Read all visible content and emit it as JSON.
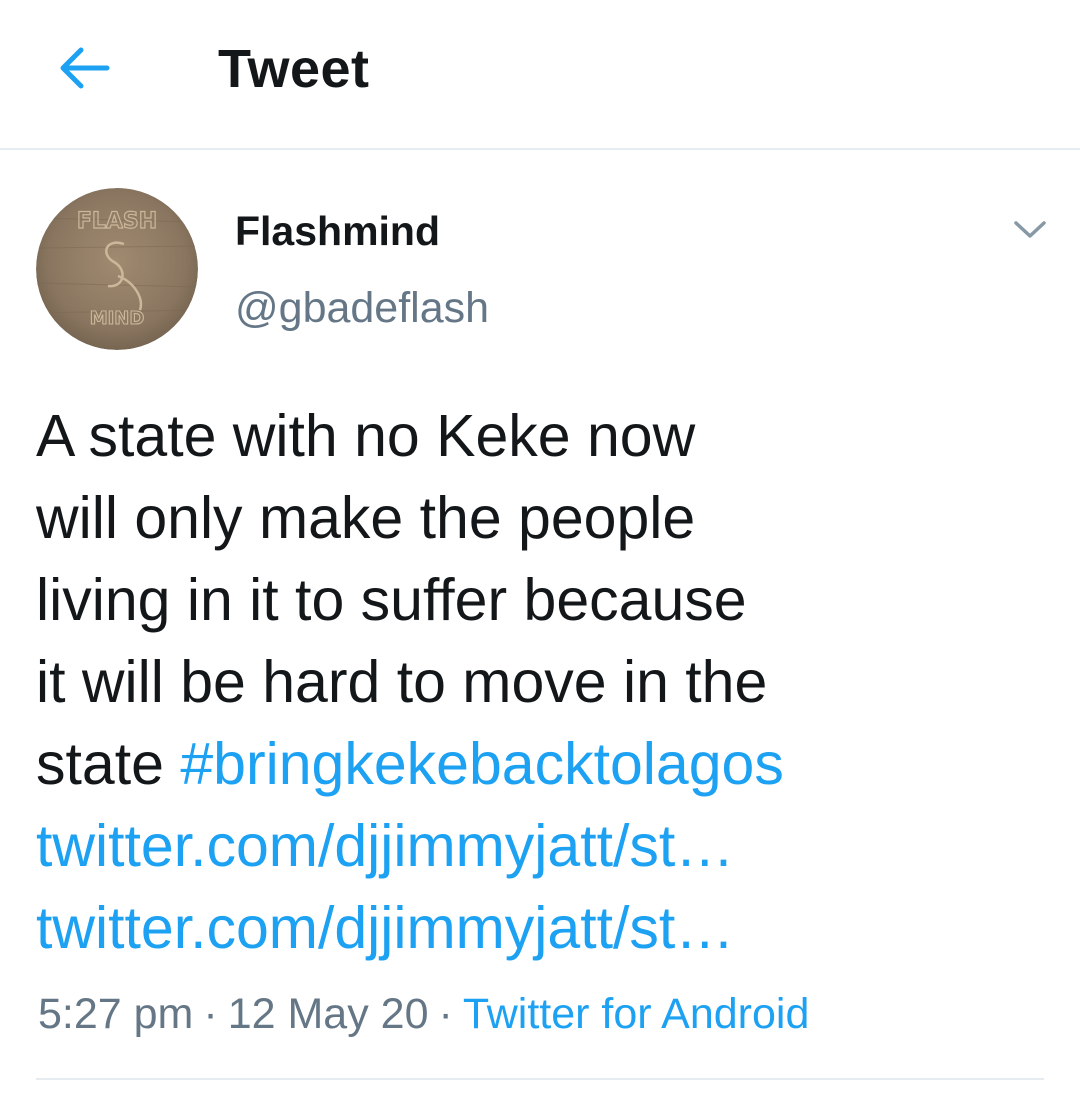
{
  "header": {
    "title": "Tweet",
    "back_icon": "arrow-left-icon",
    "accent_color": "#1da1f2"
  },
  "tweet": {
    "author": {
      "display_name": "Flashmind",
      "handle": "@gbadeflash",
      "avatar_text_top": "FLASH",
      "avatar_text_bottom": "MIND"
    },
    "more_icon": "chevron-down-icon",
    "text_lines": [
      "A state with no Keke now",
      "will only make the people",
      "living in it to suffer because",
      "it will be hard to move in the",
      "state "
    ],
    "hashtag": "#bringkekebacktolagos",
    "links": [
      "twitter.com/djjimmyjatt/st…",
      "twitter.com/djjimmyjatt/st…"
    ],
    "time": "5:27 pm",
    "date": "12 May 20",
    "separator": "·",
    "source": "Twitter for Android"
  },
  "colors": {
    "text": "#14171a",
    "secondary": "#657786",
    "link": "#1da1f2",
    "divider": "#e6ecf0"
  }
}
